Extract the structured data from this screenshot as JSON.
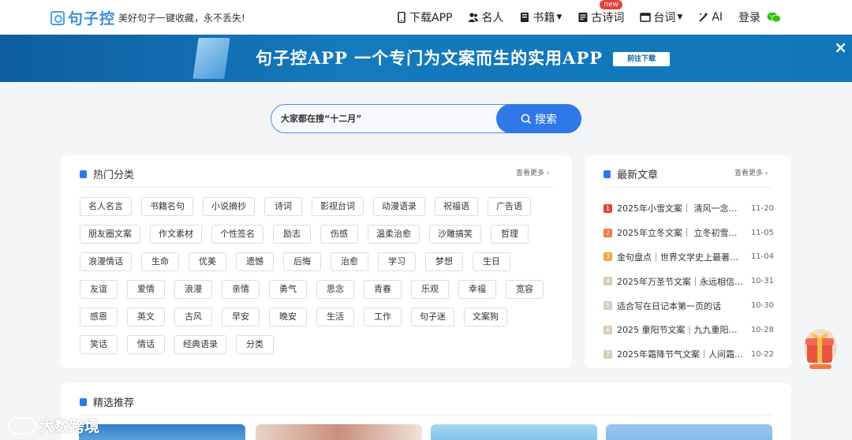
{
  "header": {
    "logo_text": "句子控",
    "slogan": "美好句子一键收藏，永不丢失!",
    "nav": [
      {
        "label": "下载APP",
        "icon": "phone-icon"
      },
      {
        "label": "名人",
        "icon": "people-icon"
      },
      {
        "label": "书籍",
        "icon": "book-icon",
        "dropdown": true
      },
      {
        "label": "古诗词",
        "icon": "poem-icon",
        "badge": "new"
      },
      {
        "label": "台词",
        "icon": "film-icon",
        "dropdown": true
      },
      {
        "label": "AI",
        "icon": "magic-wand-icon"
      }
    ],
    "login": "登录",
    "accent": "#2f78e8"
  },
  "banner": {
    "title": "句子控APP 一个专门为文案而生的实用APP",
    "button": "前往下载",
    "close": "×"
  },
  "search": {
    "placeholder": "大家都在搜“十二月”",
    "button": "搜索"
  },
  "hot": {
    "title": "热门分类",
    "more": "查看更多 ›",
    "tags": [
      "名人名言",
      "书籍名句",
      "小说摘抄",
      "诗词",
      "影视台词",
      "动漫语录",
      "祝福语",
      "广告语",
      "朋友圈文案",
      "作文素材",
      "个性签名",
      "励志",
      "伤感",
      "温柔治愈",
      "沙雕搞笑",
      "哲理",
      "浪漫情话",
      "生命",
      "优美",
      "遗憾",
      "后悔",
      "治愈",
      "学习",
      "梦想",
      "生日",
      "友谊",
      "爱情",
      "浪漫",
      "亲情",
      "勇气",
      "思念",
      "青春",
      "乐观",
      "幸福",
      "宽容",
      "感恩",
      "英文",
      "古风",
      "早安",
      "晚安",
      "生活",
      "工作",
      "句子迷",
      "文案狗",
      "笑话",
      "情话",
      "经典语录",
      "分类"
    ]
  },
  "latest": {
    "title": "最新文章",
    "more": "查看更多 ›",
    "items": [
      {
        "rank": "1",
        "title": "2025年小雪文案｜ 清风一念，…",
        "date": "11-20",
        "color": "#e5413c"
      },
      {
        "rank": "2",
        "title": "2025年立冬文案｜ 立冬初雪落…",
        "date": "11-05",
        "color": "#f07b3f"
      },
      {
        "rank": "3",
        "title": "金句盘点｜世界文学史上最著名…",
        "date": "11-04",
        "color": "#f3a73b"
      },
      {
        "rank": "4",
        "title": "2025年万圣节文案｜永远相信 …",
        "date": "10-31",
        "color": "#d9cbb8"
      },
      {
        "rank": "5",
        "title": "适合写在日记本第一页的话",
        "date": "10-30",
        "color": "#d9cbb8"
      },
      {
        "rank": "6",
        "title": "2025 重阳节文案｜九九重阳，…",
        "date": "10-28",
        "color": "#d9cbb8"
      },
      {
        "rank": "7",
        "title": "2025年霜降节气文案｜人间霜…",
        "date": "10-22",
        "color": "#d9cbb8"
      }
    ]
  },
  "pick": {
    "title": "精选推荐"
  },
  "watermark": "大数跨境"
}
